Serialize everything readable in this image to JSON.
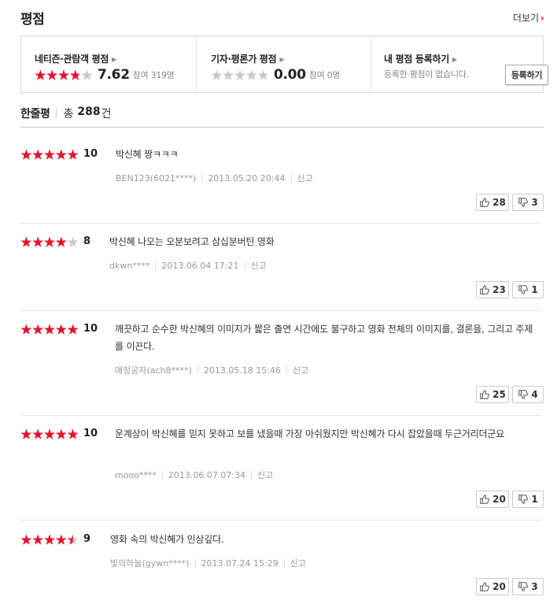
{
  "header": {
    "title": "평점",
    "more_label": "더보기"
  },
  "score_box": {
    "audience": {
      "title": "네티즌·관람객 평점",
      "score": "7.62",
      "rating": 3.81,
      "count": "참여 319명"
    },
    "critic": {
      "title": "기자·평론가 평점",
      "score": "0.00",
      "rating": 0,
      "count": "참여 0명"
    },
    "mine": {
      "title": "내 평점 등록하기",
      "empty_text": "등록한 평점이 없습니다.",
      "button_label": "등록하기"
    }
  },
  "summary": {
    "label": "한줄평",
    "prefix": "총",
    "count": "288",
    "suffix": "건"
  },
  "colors": {
    "star_on": "#e8112d",
    "star_off": "#c8c8c8"
  },
  "reviews": [
    {
      "score": "10",
      "rating": 5,
      "text": "박신혜 짱ㅋㅋㅋ",
      "user": "BEN123(6021****)",
      "date": "2013.05.20 20:44",
      "report": "신고",
      "up": "28",
      "down": "3"
    },
    {
      "score": "8",
      "rating": 4,
      "text": "박신혜 나오는 오분보려고 삼십분버틴 영화",
      "user": "dkwn****",
      "date": "2013.06.04 17:21",
      "report": "신고",
      "up": "23",
      "down": "1"
    },
    {
      "score": "10",
      "rating": 5,
      "text": "깨끗하고 순수한 박신혜의 이미지가 짧은 출연 시간에도 불구하고 영화 전체의 이미지를, 결론을, 그리고 주제를 이끈다.",
      "user": "애정공자(ach8****)",
      "date": "2013.05.18 15:46",
      "report": "신고",
      "up": "25",
      "down": "4"
    },
    {
      "score": "10",
      "rating": 5,
      "text": "운계상이 박신혜를 믿지 못하고 보를 냈을때 가장 아쉬웠지만 박신혜가 다시 잡았을때 두근거리더군요",
      "user": "mooo****",
      "date": "2013.06.07 07:34",
      "report": "신고",
      "up": "20",
      "down": "1"
    },
    {
      "score": "9",
      "rating": 4.5,
      "text": "영화 속의 박신혜가 인상깊다.",
      "user": "빛의하늘(gywn****)",
      "date": "2013.07.24 15:29",
      "report": "신고",
      "up": "20",
      "down": "3"
    }
  ]
}
